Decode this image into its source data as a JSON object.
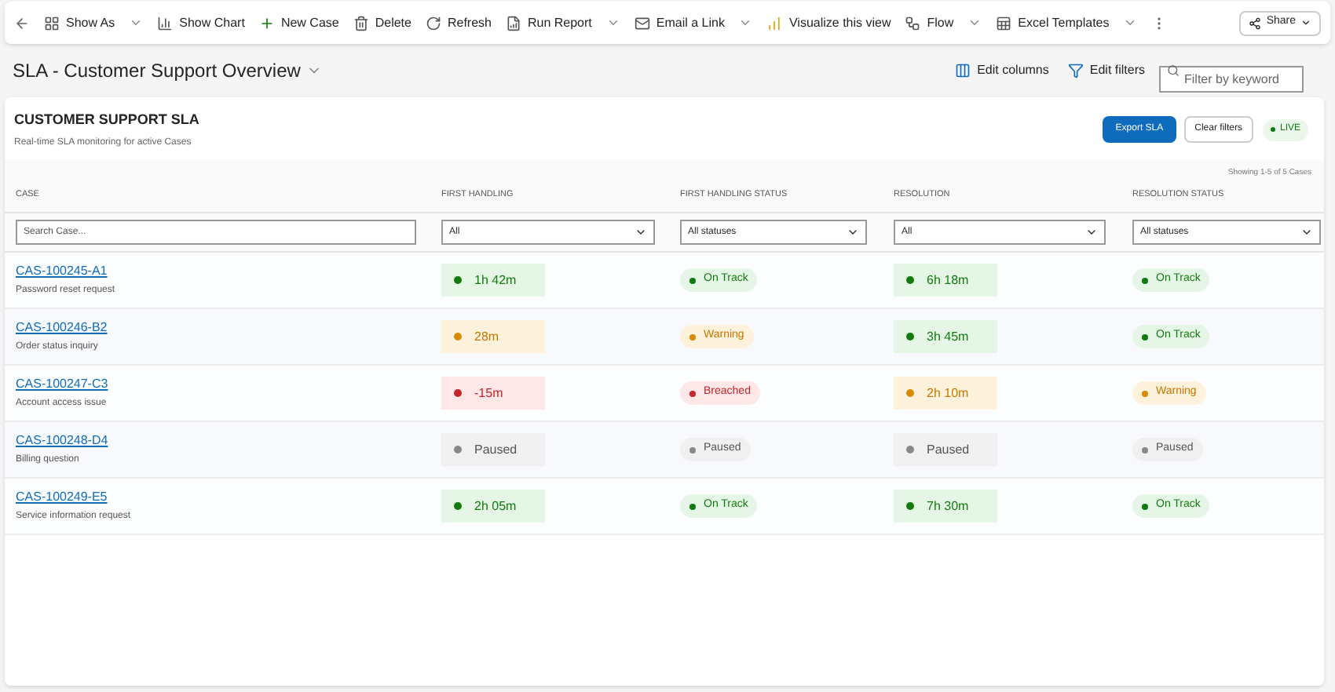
{
  "toolbar": {
    "items": [
      {
        "kind": "back"
      },
      {
        "kind": "button",
        "label": "Show As"
      },
      {
        "kind": "caret"
      },
      {
        "kind": "button",
        "label": "Show Chart"
      },
      {
        "kind": "button",
        "label": "New Case"
      },
      {
        "kind": "button",
        "label": "Delete"
      },
      {
        "kind": "button",
        "label": "Refresh"
      },
      {
        "kind": "button",
        "label": "Run Report"
      },
      {
        "kind": "caret"
      },
      {
        "kind": "button",
        "label": "Email a Link"
      },
      {
        "kind": "caret"
      },
      {
        "kind": "button",
        "label": "Visualize this view"
      },
      {
        "kind": "button",
        "label": "Flow"
      },
      {
        "kind": "caret"
      },
      {
        "kind": "button",
        "label": "Excel Templates"
      },
      {
        "kind": "caret"
      },
      {
        "kind": "more"
      }
    ],
    "share": "Share"
  },
  "view": {
    "title": "SLA - Customer Support Overview",
    "edit_columns": "Edit columns",
    "edit_filters": "Edit filters",
    "filter_placeholder": "Filter by keyword"
  },
  "card": {
    "title": "CUSTOMER SUPPORT SLA",
    "subtitle": "Real-time SLA monitoring for active Cases",
    "export": "Export SLA",
    "clear": "Clear filters",
    "live": "LIVE",
    "count": "Showing 1-5 of 5 Cases"
  },
  "table": {
    "columns": [
      "CASE",
      "FIRST HANDLING",
      "FIRST HANDLING STATUS",
      "RESOLUTION",
      "RESOLUTION STATUS"
    ],
    "filters": [
      {
        "kind": "search",
        "placeholder": "Search Case..."
      },
      {
        "kind": "select",
        "value": "All"
      },
      {
        "kind": "select",
        "value": "All statuses"
      },
      {
        "kind": "select",
        "value": "All"
      },
      {
        "kind": "select",
        "value": "All statuses"
      }
    ],
    "rows": [
      {
        "id": "CAS-100245-A1",
        "desc": "Password reset request",
        "first": {
          "text": "1h 42m",
          "kind": "ok"
        },
        "first_status": {
          "text": "On Track",
          "kind": "ok"
        },
        "resolution": {
          "text": "6h 18m",
          "kind": "ok"
        },
        "resolution_status": {
          "text": "On Track",
          "kind": "ok"
        }
      },
      {
        "id": "CAS-100246-B2",
        "desc": "Order status inquiry",
        "first": {
          "text": "28m",
          "kind": "warn"
        },
        "first_status": {
          "text": "Warning",
          "kind": "warn"
        },
        "resolution": {
          "text": "3h 45m",
          "kind": "ok"
        },
        "resolution_status": {
          "text": "On Track",
          "kind": "ok"
        }
      },
      {
        "id": "CAS-100247-C3",
        "desc": "Account access issue",
        "first": {
          "text": "-15m",
          "kind": "breach"
        },
        "first_status": {
          "text": "Breached",
          "kind": "breach"
        },
        "resolution": {
          "text": "2h 10m",
          "kind": "warn"
        },
        "resolution_status": {
          "text": "Warning",
          "kind": "warn"
        }
      },
      {
        "id": "CAS-100248-D4",
        "desc": "Billing question",
        "first": {
          "text": "Paused",
          "kind": "paused"
        },
        "first_status": {
          "text": "Paused",
          "kind": "paused"
        },
        "resolution": {
          "text": "Paused",
          "kind": "paused"
        },
        "resolution_status": {
          "text": "Paused",
          "kind": "paused"
        }
      },
      {
        "id": "CAS-100249-E5",
        "desc": "Service information request",
        "first": {
          "text": "2h 05m",
          "kind": "ok"
        },
        "first_status": {
          "text": "On Track",
          "kind": "ok"
        },
        "resolution": {
          "text": "7h 30m",
          "kind": "ok"
        },
        "resolution_status": {
          "text": "On Track",
          "kind": "ok"
        }
      }
    ]
  }
}
